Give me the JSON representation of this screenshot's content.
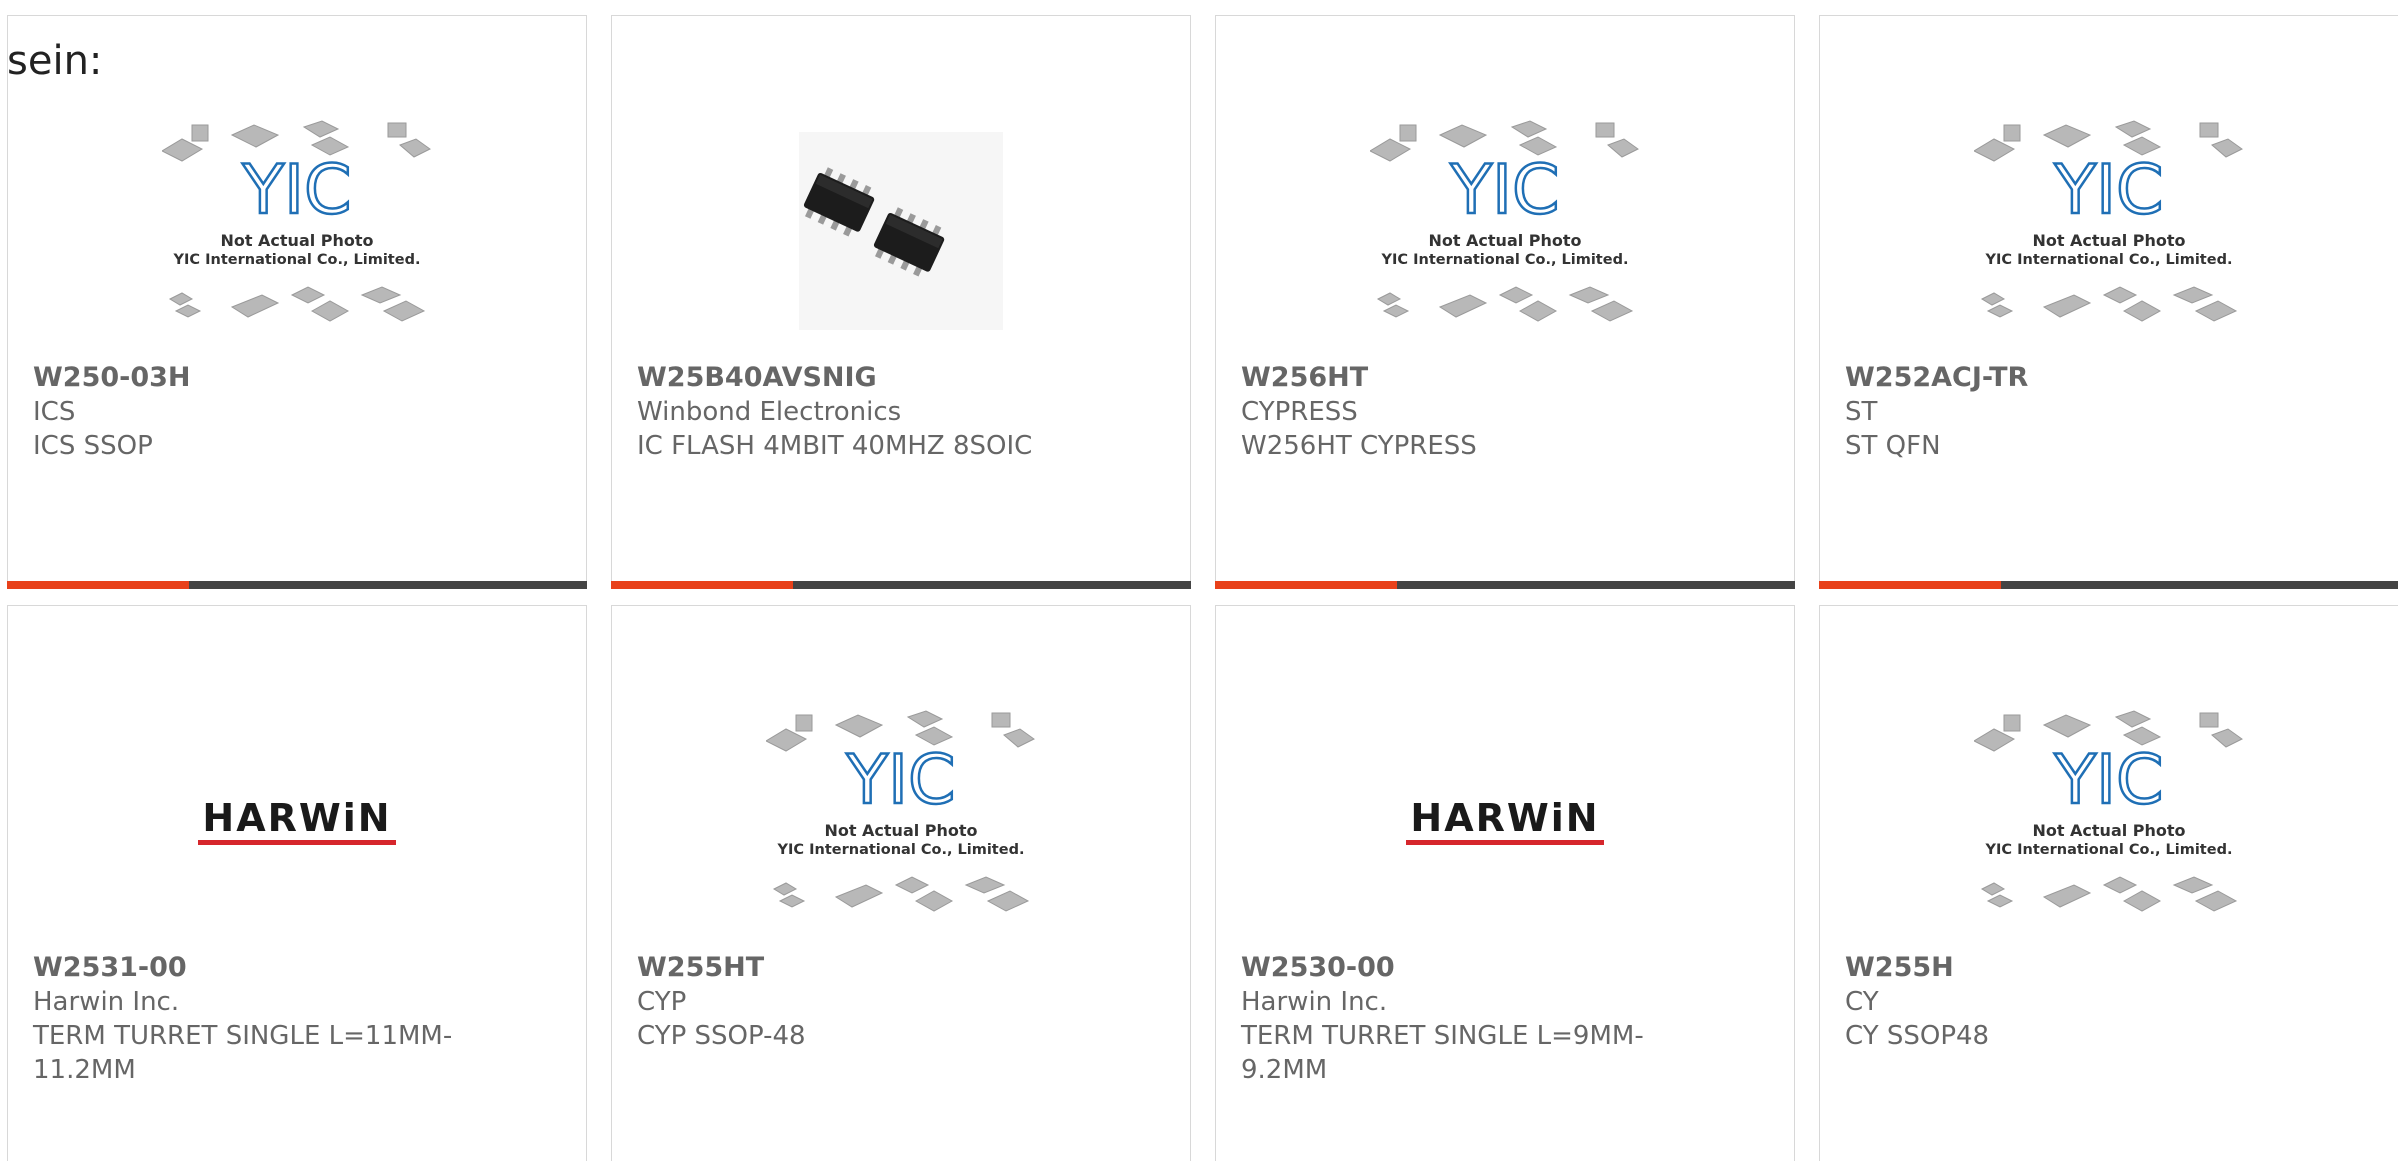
{
  "intro_text": "sein:",
  "colors": {
    "accent": "#e8411a",
    "bar": "#444444",
    "text": "#666666",
    "harwin_red": "#d6262c"
  },
  "placeholder_image": {
    "caption_line1": "Not Actual Photo",
    "caption_line2": "YIC International Co., Limited.",
    "logo_text": "YIC"
  },
  "harwin_logo_text": "HARWiN",
  "products": [
    {
      "part_number": "W250-03H",
      "manufacturer": "ICS",
      "description": "ICS SSOP",
      "image": "yic-placeholder"
    },
    {
      "part_number": "W25B40AVSNIG",
      "manufacturer": "Winbond Electronics",
      "description": "IC FLASH 4MBIT 40MHZ 8SOIC",
      "image": "soic-chip-photo"
    },
    {
      "part_number": "W256HT",
      "manufacturer": "CYPRESS",
      "description": "W256HT CYPRESS",
      "image": "yic-placeholder"
    },
    {
      "part_number": "W252ACJ-TR",
      "manufacturer": "ST",
      "description": "ST QFN",
      "image": "yic-placeholder"
    },
    {
      "part_number": "W2531-00",
      "manufacturer": "Harwin Inc.",
      "description": "TERM TURRET SINGLE L=11MM-11.2MM",
      "image": "harwin-logo"
    },
    {
      "part_number": "W255HT",
      "manufacturer": "CYP",
      "description": "CYP SSOP-48",
      "image": "yic-placeholder"
    },
    {
      "part_number": "W2530-00",
      "manufacturer": "Harwin Inc.",
      "description": "TERM TURRET SINGLE L=9MM-9.2MM",
      "image": "harwin-logo"
    },
    {
      "part_number": "W255H",
      "manufacturer": "CY",
      "description": "CY SSOP48",
      "image": "yic-placeholder"
    }
  ]
}
